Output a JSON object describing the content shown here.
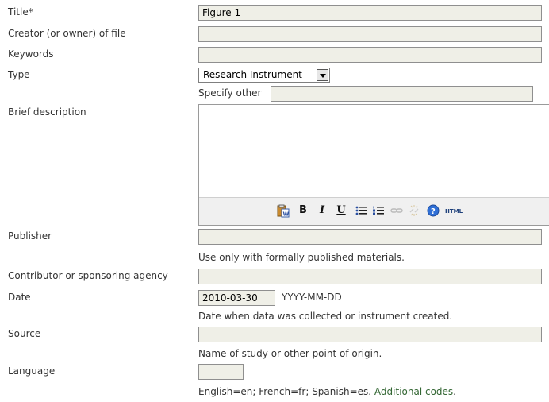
{
  "fields": {
    "title": {
      "label": "Title*",
      "value": "Figure 1"
    },
    "creator": {
      "label": "Creator (or owner) of file",
      "value": ""
    },
    "keywords": {
      "label": "Keywords",
      "value": ""
    },
    "type": {
      "label": "Type",
      "selected": "Research Instrument",
      "specify_label": "Specify other",
      "specify_value": ""
    },
    "description": {
      "label": "Brief description",
      "value": ""
    },
    "publisher": {
      "label": "Publisher",
      "value": "",
      "note": "Use only with formally published materials."
    },
    "contributor": {
      "label": "Contributor or sponsoring agency",
      "value": ""
    },
    "date": {
      "label": "Date",
      "value": "2010-03-30",
      "format": "YYYY-MM-DD",
      "note": "Date when data was collected or instrument created."
    },
    "source": {
      "label": "Source",
      "value": "",
      "note": "Name of study or other point of origin."
    },
    "language": {
      "label": "Language",
      "value": "",
      "note": "English=en; French=fr; Spanish=es.",
      "link": "Additional codes"
    }
  },
  "toolbar": {
    "bold": "B",
    "italic": "I",
    "underline": "U",
    "html": "HTML"
  },
  "colors": {
    "input_bg": "#efefe7",
    "link": "#336633",
    "toolbar_bg": "#f0f0f0"
  }
}
